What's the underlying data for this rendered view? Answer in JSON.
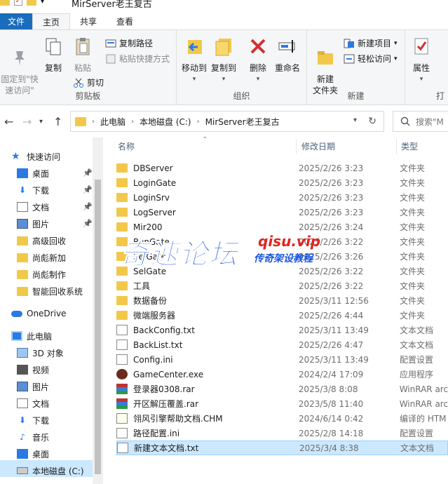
{
  "window": {
    "title": "MirServer老王复古"
  },
  "ribbon": {
    "tabs": [
      "文件",
      "主页",
      "共享",
      "查看"
    ],
    "clipboard": {
      "label": "剪贴板",
      "pin_quick": "固定到\"快\n速访问\"",
      "copy": "复制",
      "paste": "粘贴",
      "copy_path": "复制路径",
      "paste_shortcut": "粘贴快捷方式",
      "cut": "剪切"
    },
    "organize": {
      "label": "组织",
      "move_to": "移动到",
      "copy_to": "复制到",
      "delete": "删除",
      "rename": "重命名"
    },
    "new": {
      "label": "新建",
      "new_folder": "新建\n文件夹",
      "new_item": "新建项目",
      "easy_access": "轻松访问"
    },
    "open": {
      "label": "打",
      "properties": "属性"
    }
  },
  "address": {
    "crumbs": [
      "此电脑",
      "本地磁盘 (C:)",
      "MirServer老王复古"
    ],
    "search_placeholder": "搜索\"M"
  },
  "nav": {
    "quick_access": "快速访问",
    "items": [
      {
        "label": "桌面",
        "icon": "desktop-icon",
        "pinned": true
      },
      {
        "label": "下载",
        "icon": "download-icon",
        "pinned": true
      },
      {
        "label": "文档",
        "icon": "document-icon",
        "pinned": true
      },
      {
        "label": "图片",
        "icon": "picture-icon",
        "pinned": true
      },
      {
        "label": "高级回收",
        "icon": "folder-icon",
        "pinned": false
      },
      {
        "label": "尚彪新加",
        "icon": "folder-icon",
        "pinned": false
      },
      {
        "label": "尚彪制作",
        "icon": "folder-icon",
        "pinned": false
      },
      {
        "label": "智能回收系统",
        "icon": "folder-icon",
        "pinned": false
      }
    ],
    "onedrive": "OneDrive",
    "this_pc": "此电脑",
    "pc_items": [
      {
        "label": "3D 对象",
        "icon": "3d-objects-icon"
      },
      {
        "label": "视频",
        "icon": "video-icon"
      },
      {
        "label": "图片",
        "icon": "picture-icon"
      },
      {
        "label": "文档",
        "icon": "document-icon"
      },
      {
        "label": "下载",
        "icon": "download-icon"
      },
      {
        "label": "音乐",
        "icon": "music-icon"
      },
      {
        "label": "桌面",
        "icon": "desktop-icon"
      },
      {
        "label": "本地磁盘 (C:)",
        "icon": "drive-icon"
      }
    ]
  },
  "columns": {
    "name": "名称",
    "date": "修改日期",
    "type": "类型"
  },
  "files": [
    {
      "name": "DBServer",
      "date": "2025/2/26 3:23",
      "type": "文件夹",
      "kind": "folder"
    },
    {
      "name": "LoginGate",
      "date": "2025/2/26 3:23",
      "type": "文件夹",
      "kind": "folder"
    },
    {
      "name": "LoginSrv",
      "date": "2025/2/26 3:23",
      "type": "文件夹",
      "kind": "folder"
    },
    {
      "name": "LogServer",
      "date": "2025/2/26 3:23",
      "type": "文件夹",
      "kind": "folder"
    },
    {
      "name": "Mir200",
      "date": "2025/2/26 3:24",
      "type": "文件夹",
      "kind": "folder"
    },
    {
      "name": "RunGate",
      "date": "2025/2/26 3:22",
      "type": "文件夹",
      "kind": "folder"
    },
    {
      "name": "SelGate",
      "date": "2025/2/26 3:26",
      "type": "文件夹",
      "kind": "folder"
    },
    {
      "name": "SelGate",
      "date": "2025/2/26 3:22",
      "type": "文件夹",
      "kind": "folder"
    },
    {
      "name": "工具",
      "date": "2025/2/26 3:22",
      "type": "文件夹",
      "kind": "folder"
    },
    {
      "name": "数据备份",
      "date": "2025/3/11 12:56",
      "type": "文件夹",
      "kind": "folder"
    },
    {
      "name": "微端服务器",
      "date": "2025/2/26 4:44",
      "type": "文件夹",
      "kind": "folder"
    },
    {
      "name": "BackConfig.txt",
      "date": "2025/3/11 13:49",
      "type": "文本文档",
      "kind": "txt"
    },
    {
      "name": "BackList.txt",
      "date": "2025/2/26 4:47",
      "type": "文本文档",
      "kind": "txt"
    },
    {
      "name": "Config.ini",
      "date": "2025/3/11 13:49",
      "type": "配置设置",
      "kind": "ini"
    },
    {
      "name": "GameCenter.exe",
      "date": "2024/2/4 17:09",
      "type": "应用程序",
      "kind": "exe"
    },
    {
      "name": "登录器0308.rar",
      "date": "2025/3/8 8:08",
      "type": "WinRAR arc",
      "kind": "rar"
    },
    {
      "name": "开区解压覆盖.rar",
      "date": "2023/5/8 11:40",
      "type": "WinRAR arc",
      "kind": "rar"
    },
    {
      "name": "翎风引擎帮助文档.CHM",
      "date": "2024/6/14 0:42",
      "type": "编译的 HTM",
      "kind": "chm"
    },
    {
      "name": "路径配置.ini",
      "date": "2025/2/8 14:18",
      "type": "配置设置",
      "kind": "ini"
    },
    {
      "name": "新建文本文档.txt",
      "date": "2025/3/4 8:38",
      "type": "文本文档",
      "kind": "txt"
    }
  ],
  "selected_index": 19,
  "watermark": {
    "main": "奇速论坛",
    "url": "qisu.vip",
    "sub": "传奇架设教程"
  }
}
